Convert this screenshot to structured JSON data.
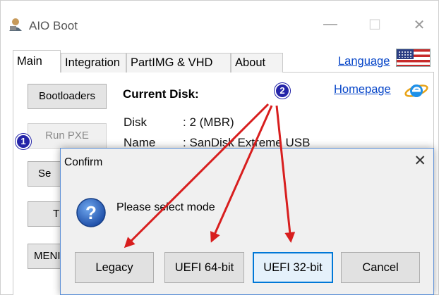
{
  "window": {
    "title": "AIO Boot",
    "minimize_glyph": "—",
    "maximize_glyph": "☐",
    "close_glyph": "✕"
  },
  "tabs": [
    {
      "label": "Main",
      "active": true
    },
    {
      "label": "Integration",
      "active": false
    },
    {
      "label": "PartIMG & VHD",
      "active": false
    },
    {
      "label": "About",
      "active": false
    }
  ],
  "links": {
    "language": "Language",
    "homepage": "Homepage"
  },
  "side_buttons": {
    "bootloaders": "Bootloaders",
    "run_pxe": "Run PXE",
    "se": "Se",
    "t": "T",
    "menu": "MENI"
  },
  "disk_info": {
    "heading": "Current Disk:",
    "rows": [
      {
        "key": "Disk",
        "value": ": 2 (MBR)"
      },
      {
        "key": "Name",
        "value": ": SanDisk Extreme USB"
      }
    ]
  },
  "callouts": {
    "one": "1",
    "two": "2"
  },
  "dialog": {
    "title": "Confirm",
    "close_glyph": "✕",
    "message": "Please select mode",
    "buttons": {
      "legacy": "Legacy",
      "uefi64": "UEFI 64-bit",
      "uefi32": "UEFI 32-bit",
      "cancel": "Cancel"
    }
  },
  "colors": {
    "link": "#0645c8",
    "callout": "#2525a8",
    "arrow": "#d81e1e",
    "focus_border": "#0078d7",
    "dialog_bg": "#f0f0f0"
  },
  "icons": [
    "app-icon",
    "us-flag-icon",
    "internet-explorer-icon",
    "question-icon"
  ]
}
